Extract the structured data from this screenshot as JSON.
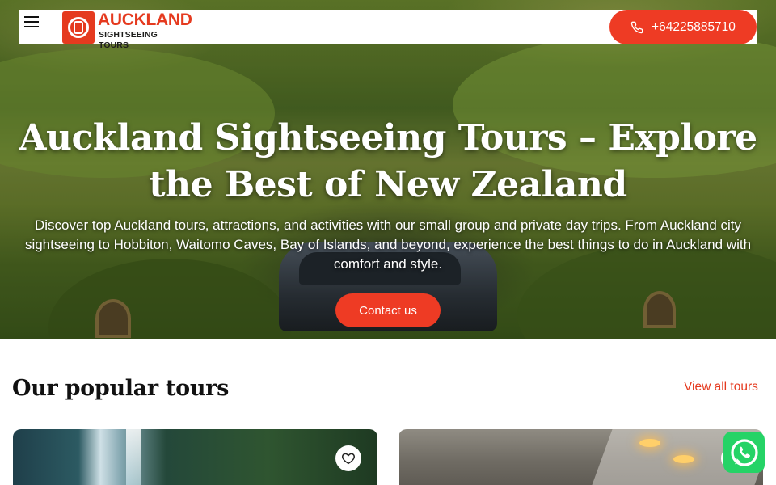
{
  "header": {
    "menu_icon": "hamburger-menu-icon",
    "logo": {
      "title": "AUCKLAND",
      "subtitle": "SIGHTSEEING TOURS"
    },
    "phone": {
      "number": "+64225885710",
      "icon": "phone-icon"
    }
  },
  "hero": {
    "title": "Auckland Sightseeing Tours – Explore the Best of New Zealand",
    "subtitle": "Discover top Auckland tours, attractions, and activities with our small group and private day trips. From Auckland city sightseeing to Hobbiton, Waitomo Caves, Bay of Islands, and beyond, experience the best things to do in Auckland with comfort and style.",
    "cta_label": "Contact us"
  },
  "popular": {
    "title": "Our popular tours",
    "view_all_label": "View all tours",
    "cards": [
      {
        "favorite_icon": "heart-icon"
      },
      {
        "favorite_icon": "heart-icon"
      }
    ]
  },
  "whatsapp": {
    "icon": "whatsapp-icon"
  },
  "colors": {
    "accent": "#ee3b24",
    "brand_red": "#e53a1f",
    "whatsapp": "#25d366"
  }
}
